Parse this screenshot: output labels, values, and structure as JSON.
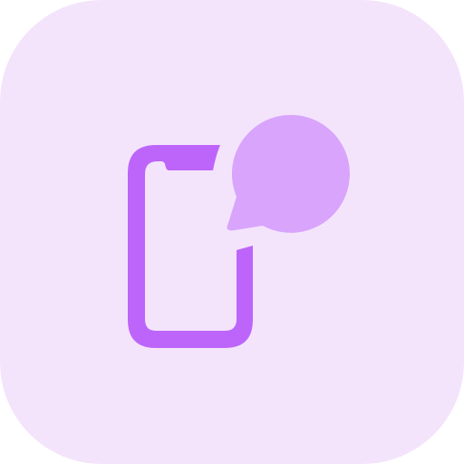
{
  "icon": {
    "name": "mobile-chat-icon",
    "colors": {
      "background": "#F3E4FC",
      "phone": "#BD65FA",
      "bubble": "#D9A4FC"
    }
  }
}
